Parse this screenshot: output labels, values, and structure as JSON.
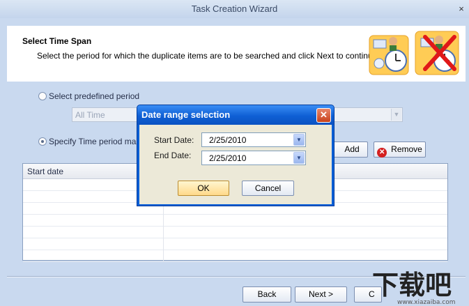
{
  "window": {
    "title": "Task Creation Wizard",
    "close_glyph": "×"
  },
  "header": {
    "title": "Select Time Span",
    "description": "Select the period for which the duplicate items are to be searched and click Next to continue."
  },
  "options": {
    "predefined_label": "Select predefined period",
    "predefined_value": "All Time",
    "manual_label": "Specify Time period manua"
  },
  "buttons": {
    "add": "Add",
    "remove": "Remove",
    "back": "Back",
    "next": "Next >",
    "cancel_partial": "C"
  },
  "grid": {
    "columns": [
      "Start date",
      ""
    ],
    "rows": 7
  },
  "dialog": {
    "title": "Date range selection",
    "start_label": "Start Date:",
    "start_value": "2/25/2010",
    "end_label": "End Date:",
    "end_value": "2/25/2010",
    "ok": "OK",
    "cancel": "Cancel"
  },
  "watermark": {
    "text": "下载吧",
    "url": "www.xiazaiba.com"
  },
  "colors": {
    "dialog_title": "#0a5fd6",
    "background": "#c9d9ef",
    "ok_button": "#ffd98a"
  }
}
